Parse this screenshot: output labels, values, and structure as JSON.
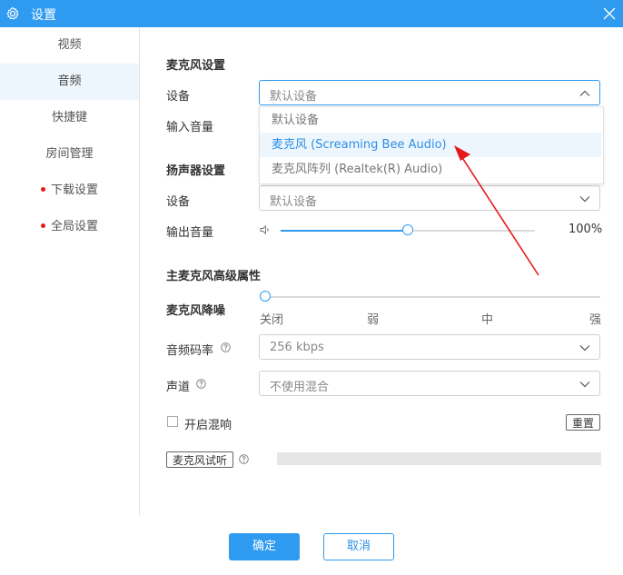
{
  "window": {
    "title": "设置",
    "icon": "gear-icon",
    "close_icon": "close-icon"
  },
  "sidebar": {
    "active_index": 1,
    "items": [
      {
        "label": "视频",
        "dot": false
      },
      {
        "label": "音频",
        "dot": true
      },
      {
        "label": "快捷键",
        "dot": false
      },
      {
        "label": "房间管理",
        "dot": false
      },
      {
        "label": "下载设置",
        "dot": true
      },
      {
        "label": "全局设置",
        "dot": true
      }
    ]
  },
  "mic": {
    "section_title": "麦克风设置",
    "device_label": "设备",
    "device_value": "默认设备",
    "volume_label": "输入音量",
    "dropdown_options": [
      "默认设备",
      "麦克风 (Screaming Bee Audio)",
      "麦克风阵列 (Realtek(R) Audio)"
    ],
    "hovered_option_index": 1
  },
  "speaker": {
    "section_title": "扬声器设置",
    "device_label": "设备",
    "device_value": "默认设备",
    "volume_label": "输出音量",
    "volume_fraction": 0.5,
    "volume_text": "100%",
    "speaker_icon": "speaker-icon"
  },
  "advanced": {
    "section_title": "主麦克风高级属性",
    "noise_label": "麦克风降噪",
    "noise_levels": [
      "关闭",
      "弱",
      "中",
      "强"
    ],
    "noise_selected_index": 0,
    "bitrate_label": "音频码率",
    "bitrate_value": "256 kbps",
    "channel_label": "声道",
    "channel_value": "不使用混合",
    "reverb_label": "开启混响",
    "reverb_checked": false,
    "reset_label": "重置",
    "test_label": "麦克风试听",
    "test_level": 0
  },
  "footer": {
    "ok_label": "确定",
    "cancel_label": "取消"
  },
  "colors": {
    "accent": "#2e9af0",
    "annotation_arrow": "#e41a1a",
    "dot": "#e41a1a"
  }
}
